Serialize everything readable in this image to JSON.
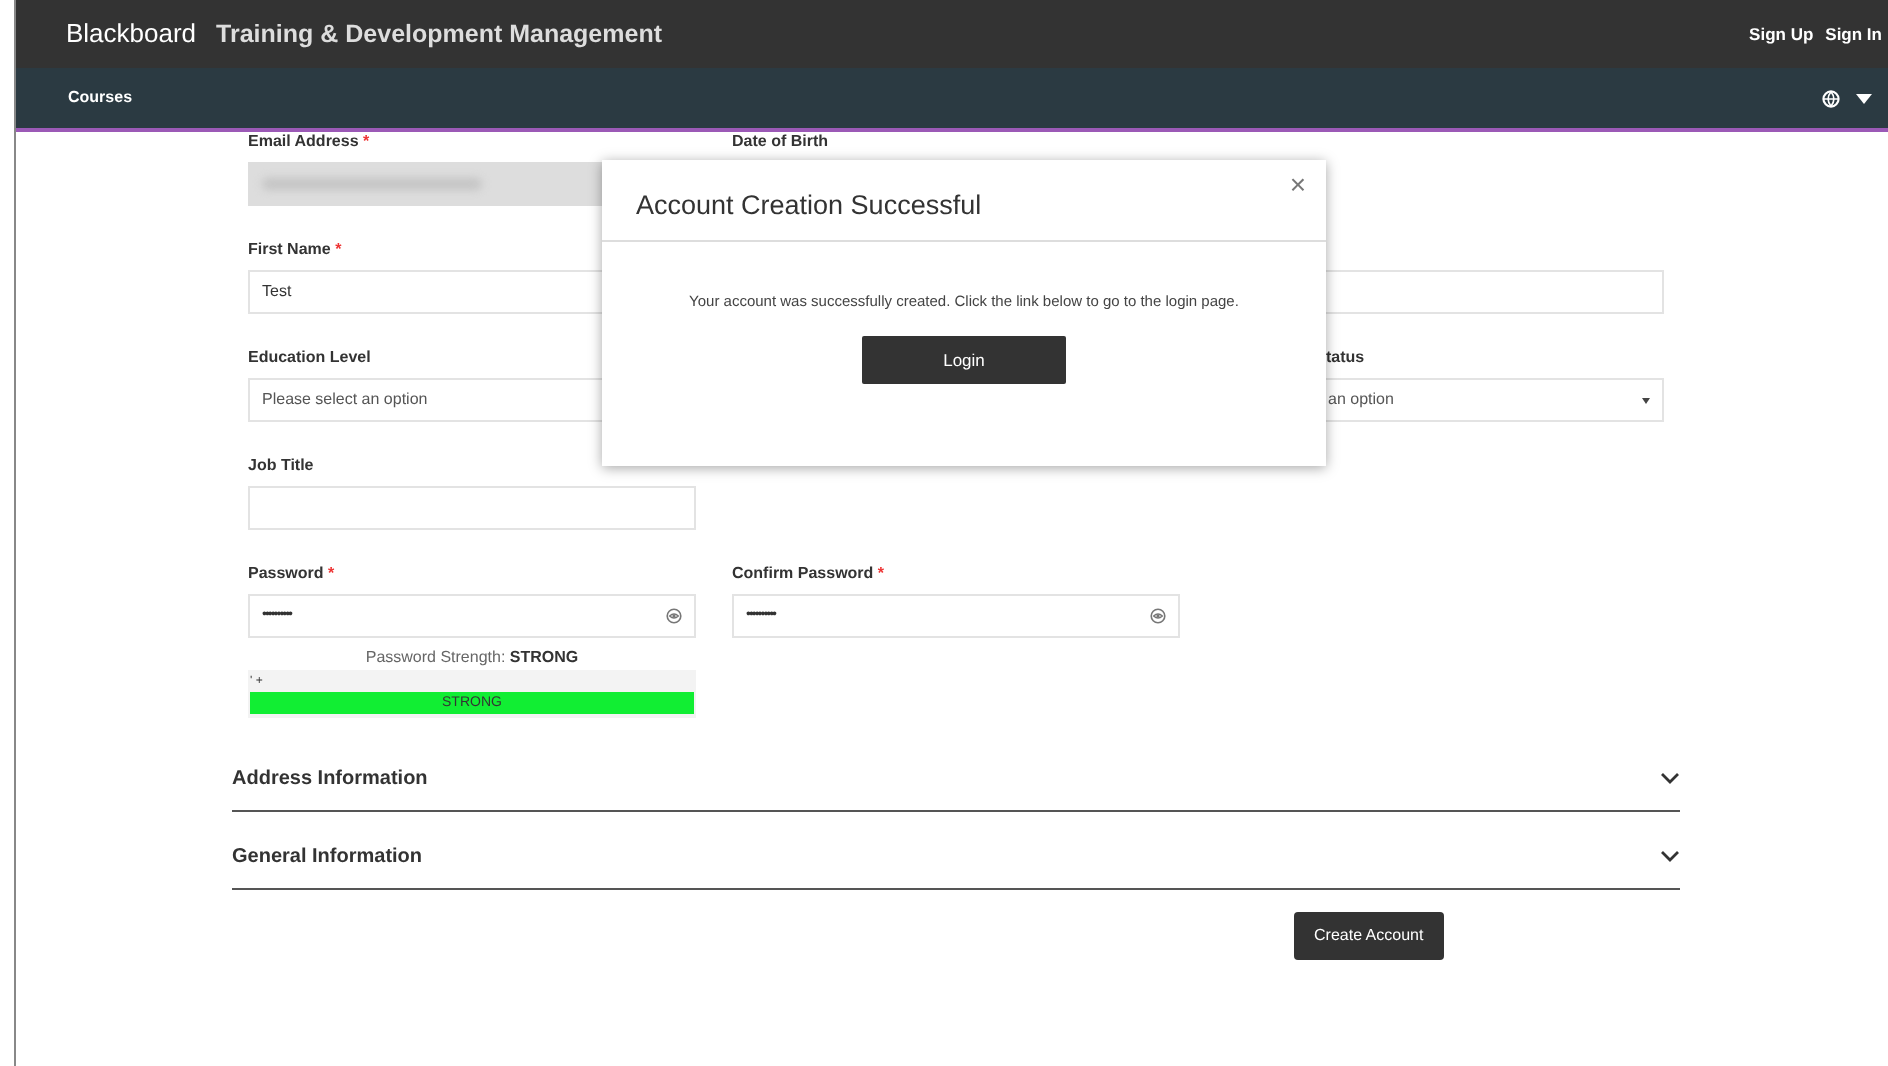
{
  "navbar": {
    "brand": "Blackboard",
    "title": "Training & Development Management",
    "links": [
      "Sign Up",
      "Sign In"
    ]
  },
  "subnav": {
    "items": [
      "Courses"
    ]
  },
  "form": {
    "rows": [
      [
        {
          "kind": "text",
          "label": "Email Address",
          "required_mark": "*",
          "disabled": true,
          "blurred": true
        },
        {
          "kind": "label",
          "label": "Date of Birth"
        },
        null
      ],
      [
        {
          "kind": "text",
          "label": "First Name",
          "required_mark": "*",
          "value": "Test"
        },
        null,
        {
          "kind": "text"
        }
      ],
      [
        {
          "kind": "select",
          "label": "Education Level",
          "placeholder": "Please select an option"
        },
        null,
        {
          "kind": "select",
          "label": "tatus",
          "placeholder": "an option"
        }
      ],
      [
        {
          "kind": "text",
          "label": "Job Title"
        },
        null,
        null
      ],
      [
        {
          "kind": "password",
          "label": "Password",
          "required_mark": "*",
          "value": "••••••••••"
        },
        {
          "kind": "password",
          "label": "Confirm Password",
          "required_mark": "*",
          "value": "••••••••••"
        },
        null
      ]
    ],
    "strength": {
      "label": "Password Strength:",
      "value": "STRONG",
      "marker": "' +",
      "meter": {
        "level": 1,
        "text": "STRONG"
      }
    }
  },
  "sections": [
    {
      "title": "Address Information",
      "expanded": false
    },
    {
      "title": "General Information",
      "expanded": false
    }
  ],
  "submit": "Create Account",
  "modal": {
    "close": "×",
    "title": "Account Creation Successful",
    "message": "Your account was successfully created. Click the link below to go to the login page.",
    "button": "Login"
  }
}
